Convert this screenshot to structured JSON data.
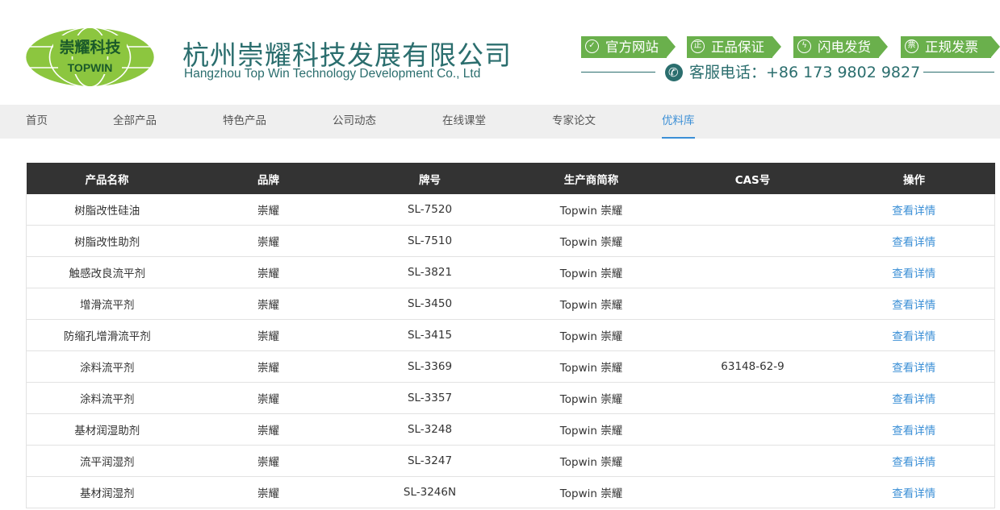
{
  "header": {
    "logo_cn": "崇耀科技",
    "logo_en": "TOPWIN",
    "company_cn": "杭州崇耀科技发展有限公司",
    "company_en": "Hangzhou Top Win Technology Development Co., Ltd",
    "badges": [
      {
        "label": "官方网站",
        "icon": "check-circle-icon"
      },
      {
        "label": "正品保证",
        "icon": "zheng-circle-icon"
      },
      {
        "label": "闪电发货",
        "icon": "lightning-icon"
      },
      {
        "label": "正规发票",
        "icon": "invoice-circle-icon"
      }
    ],
    "phone": "客服电话：+86 173 9802 9827"
  },
  "nav": {
    "items": [
      "首页",
      "全部产品",
      "特色产品",
      "公司动态",
      "在线课堂",
      "专家论文",
      "优料库"
    ],
    "active_index": 6
  },
  "table": {
    "headers": [
      "产品名称",
      "品牌",
      "牌号",
      "生产商简称",
      "CAS号",
      "操作"
    ],
    "rows": [
      [
        "树脂改性硅油",
        "崇耀",
        "SL-7520",
        "Topwin 崇耀",
        "",
        "查看详情"
      ],
      [
        "树脂改性助剂",
        "崇耀",
        "SL-7510",
        "Topwin 崇耀",
        "",
        "查看详情"
      ],
      [
        "触感改良流平剂",
        "崇耀",
        "SL-3821",
        "Topwin 崇耀",
        "",
        "查看详情"
      ],
      [
        "增滑流平剂",
        "崇耀",
        "SL-3450",
        "Topwin 崇耀",
        "",
        "查看详情"
      ],
      [
        "防缩孔增滑流平剂",
        "崇耀",
        "SL-3415",
        "Topwin 崇耀",
        "",
        "查看详情"
      ],
      [
        "涂料流平剂",
        "崇耀",
        "SL-3369",
        "Topwin 崇耀",
        "63148-62-9",
        "查看详情"
      ],
      [
        "涂料流平剂",
        "崇耀",
        "SL-3357",
        "Topwin 崇耀",
        "",
        "查看详情"
      ],
      [
        "基材润湿助剂",
        "崇耀",
        "SL-3248",
        "Topwin 崇耀",
        "",
        "查看详情"
      ],
      [
        "流平润湿剂",
        "崇耀",
        "SL-3247",
        "Topwin 崇耀",
        "",
        "查看详情"
      ],
      [
        "基材润湿剂",
        "崇耀",
        "SL-3246N",
        "Topwin 崇耀",
        "",
        "查看详情"
      ]
    ]
  },
  "colors": {
    "brand_teal": "#2b6e6e",
    "badge_green": "#6ab04c",
    "logo_green": "#8cc63f",
    "link_blue": "#3b8fd6",
    "table_header": "#333333",
    "nav_bg": "#efefef"
  }
}
